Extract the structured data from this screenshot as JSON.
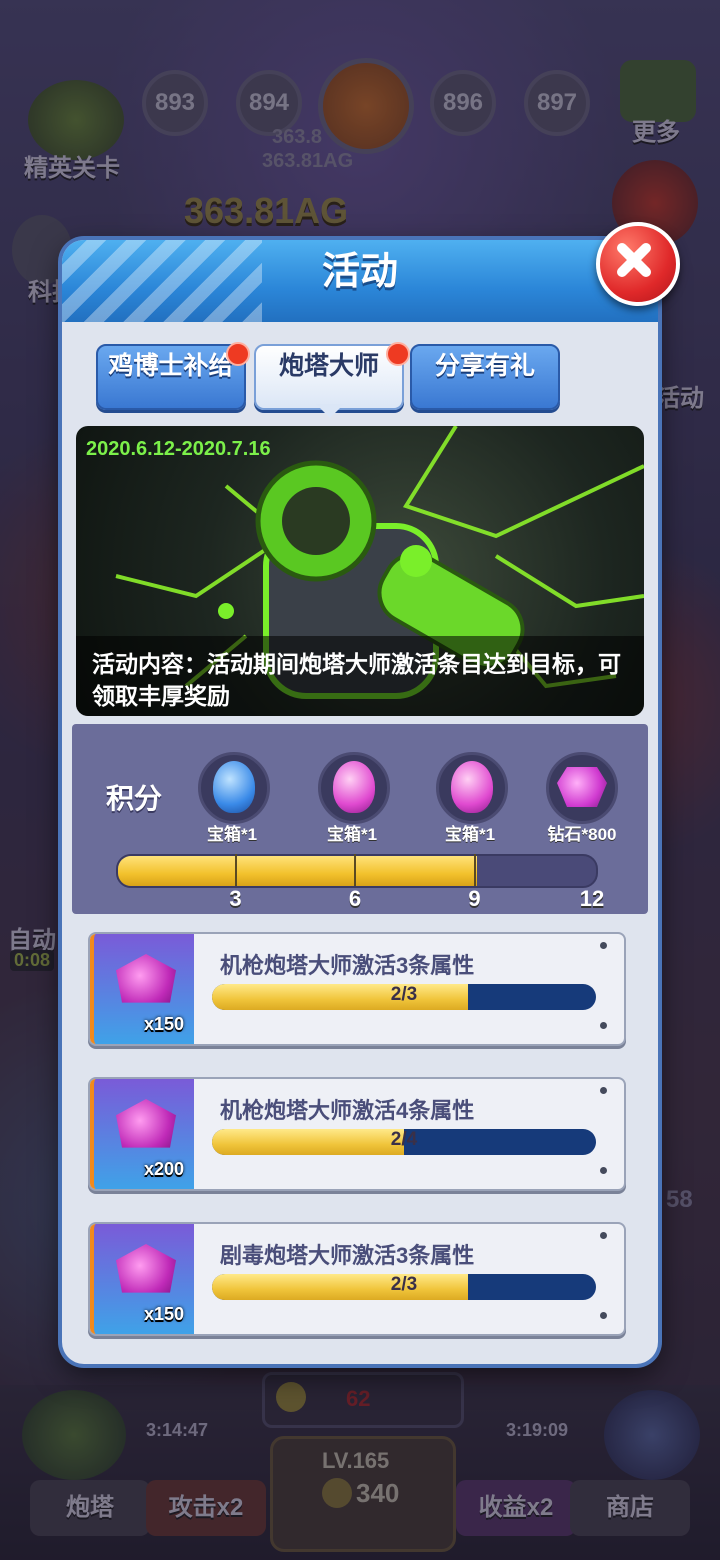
{
  "background": {
    "level_nodes": [
      "893",
      "894",
      "896",
      "897"
    ],
    "elite_stage_label": "精英关卡",
    "more_label": "更多",
    "tech_label": "科技",
    "activity_label": "活动",
    "auto_label": "自动",
    "auto_timer": "0:08",
    "money_small_1": "363.8",
    "money_small_2": "363.81AG",
    "money_big": "363.81AG",
    "side_number": "58"
  },
  "hud": {
    "top_value": "62",
    "timer_left": "3:14:47",
    "timer_right": "3:19:09",
    "level": "LV.165",
    "coins": "340",
    "turret_label": "炮塔",
    "attack_label": "攻击x2",
    "income_label": "收益x2",
    "shop_label": "商店"
  },
  "panel": {
    "title": "活动",
    "tabs": [
      {
        "label": "鸡博士补给",
        "has_badge": true,
        "active": false
      },
      {
        "label": "炮塔大师",
        "has_badge": true,
        "active": true
      },
      {
        "label": "分享有礼",
        "has_badge": false,
        "active": false
      }
    ],
    "banner": {
      "date_range": "2020.6.12-2020.7.16",
      "description": "活动内容：活动期间炮塔大师激活条目达到目标，可领取丰厚奖励"
    },
    "points": {
      "label": "积分",
      "progress_value": 9,
      "max": 12,
      "milestones": [
        {
          "threshold": "3",
          "reward": "宝箱*1",
          "icon": "blue-egg-chest-icon"
        },
        {
          "threshold": "6",
          "reward": "宝箱*1",
          "icon": "pink-egg-chest-icon"
        },
        {
          "threshold": "9",
          "reward": "宝箱*1",
          "icon": "pink-egg-chest-icon"
        },
        {
          "threshold": "12",
          "reward": "钻石*800",
          "icon": "diamond-pile-icon"
        }
      ]
    },
    "tasks": [
      {
        "title": "机枪炮塔大师激活3条属性",
        "reward_qty": "x150",
        "progress": "2/3",
        "fraction": 0.6667,
        "icon": "diamond-icon"
      },
      {
        "title": "机枪炮塔大师激活4条属性",
        "reward_qty": "x200",
        "progress": "2/4",
        "fraction": 0.5,
        "icon": "diamond-icon"
      },
      {
        "title": "剧毒炮塔大师激活3条属性",
        "reward_qty": "x150",
        "progress": "2/3",
        "fraction": 0.6667,
        "icon": "diamond-icon"
      }
    ]
  },
  "colors": {
    "accent_blue": "#2b86d8",
    "progress_gold": "#f2c12c",
    "task_bar_bg": "#163a7a",
    "badge_red": "#ee3a22",
    "date_green": "#7cf04a"
  }
}
